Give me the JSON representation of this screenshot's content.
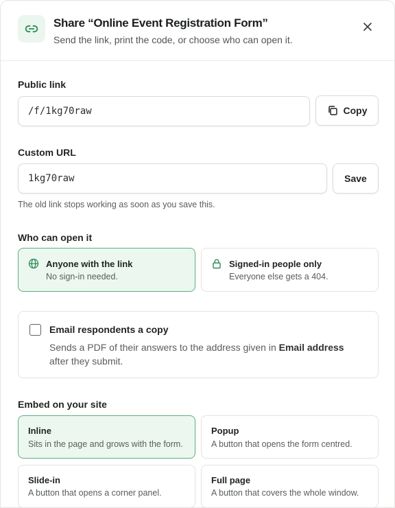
{
  "header": {
    "title": "Share “Online Event Registration Form”",
    "subtitle": "Send the link, print the code, or choose who can open it."
  },
  "public_link": {
    "label": "Public link",
    "value": "/f/1kg70raw",
    "copy_label": "Copy"
  },
  "custom_url": {
    "label": "Custom URL",
    "value": "1kg70raw",
    "save_label": "Save",
    "hint": "The old link stops working as soon as you save this."
  },
  "access": {
    "label": "Who can open it",
    "options": [
      {
        "title": "Anyone with the link",
        "desc": "No sign-in needed.",
        "selected": true,
        "icon": "globe-icon"
      },
      {
        "title": "Signed-in people only",
        "desc": "Everyone else gets a 404.",
        "selected": false,
        "icon": "lock-icon"
      }
    ]
  },
  "email_copy": {
    "title": "Email respondents a copy",
    "desc_before": "Sends a PDF of their answers to the address given in ",
    "desc_bold": "Email address",
    "desc_after": " after they submit.",
    "checked": false
  },
  "embed": {
    "label": "Embed on your site",
    "options": [
      {
        "title": "Inline",
        "desc": "Sits in the page and grows with the form.",
        "selected": true
      },
      {
        "title": "Popup",
        "desc": "A button that opens the form centred.",
        "selected": false
      },
      {
        "title": "Slide-in",
        "desc": "A button that opens a corner panel.",
        "selected": false
      },
      {
        "title": "Full page",
        "desc": "A button that covers the whole window.",
        "selected": false
      }
    ]
  },
  "colors": {
    "accent": "#2e8b57",
    "selected_bg": "#ecf8ef",
    "selected_border": "#5cae7c"
  }
}
